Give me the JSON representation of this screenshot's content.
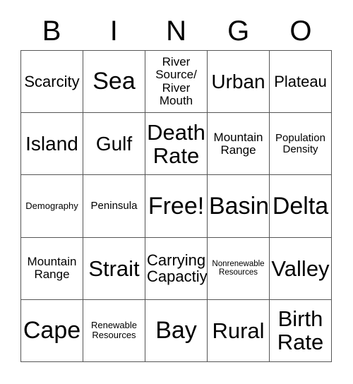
{
  "card": {
    "title": "BINGO",
    "columns": [
      "B",
      "I",
      "N",
      "G",
      "O"
    ],
    "border_color": "#555555",
    "background_color": "#ffffff",
    "text_color": "#000000",
    "free_space": "Free!",
    "rows": [
      [
        {
          "label": "Scarcity",
          "size": "m"
        },
        {
          "label": "Sea",
          "size": "xxl"
        },
        {
          "label": "River\nSource/\nRiver\nMouth",
          "size": "s"
        },
        {
          "label": "Urban",
          "size": "l"
        },
        {
          "label": "Plateau",
          "size": "m"
        }
      ],
      [
        {
          "label": "Island",
          "size": "l"
        },
        {
          "label": "Gulf",
          "size": "l"
        },
        {
          "label": "Death\nRate",
          "size": "xl"
        },
        {
          "label": "Mountain\nRange",
          "size": "s"
        },
        {
          "label": "Population\nDensity",
          "size": "xs"
        }
      ],
      [
        {
          "label": "Demography",
          "size": "xxs"
        },
        {
          "label": "Peninsula",
          "size": "xs"
        },
        {
          "label": "Free!",
          "size": "xxl"
        },
        {
          "label": "Basin",
          "size": "xxl"
        },
        {
          "label": "Delta",
          "size": "xxl"
        }
      ],
      [
        {
          "label": "Mountain\nRange",
          "size": "s"
        },
        {
          "label": "Strait",
          "size": "xl"
        },
        {
          "label": "Carrying\nCapactiy",
          "size": "m"
        },
        {
          "label": "Nonrenewable\nResources",
          "size": "tin"
        },
        {
          "label": "Valley",
          "size": "xl"
        }
      ],
      [
        {
          "label": "Cape",
          "size": "xxl"
        },
        {
          "label": "Renewable\nResources",
          "size": "xxs"
        },
        {
          "label": "Bay",
          "size": "xxl"
        },
        {
          "label": "Rural",
          "size": "xl"
        },
        {
          "label": "Birth\nRate",
          "size": "xl"
        }
      ]
    ]
  }
}
